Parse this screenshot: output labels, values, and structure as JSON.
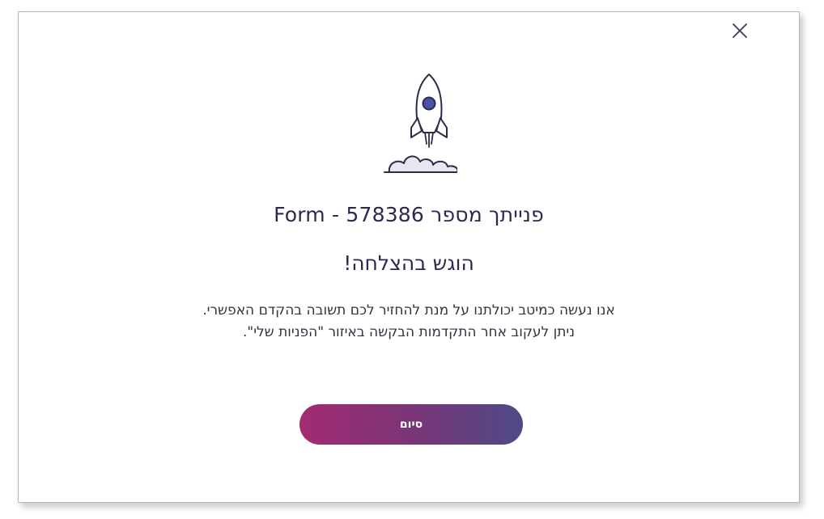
{
  "dialog": {
    "close_icon": "close-icon",
    "illustration": "rocket-launch-icon",
    "title": "פנייתך מספר 578386 - Form",
    "subtitle": "הוגש בהצלחה!",
    "message_lines": [
      "אנו נעשה כמיטב יכולתנו על מנת להחזיר לכם תשובה בהקדם האפשרי.",
      "ניתן לעקוב אחר התקדמות הבקשה באיזור \"הפניות שלי\"."
    ],
    "finish_button_label": "סיום"
  },
  "colors": {
    "title": "#2a2a4e",
    "rocket_accent": "#4a4fa8",
    "button_gradient_start": "#a32b72",
    "button_gradient_end": "#4e4a86"
  }
}
